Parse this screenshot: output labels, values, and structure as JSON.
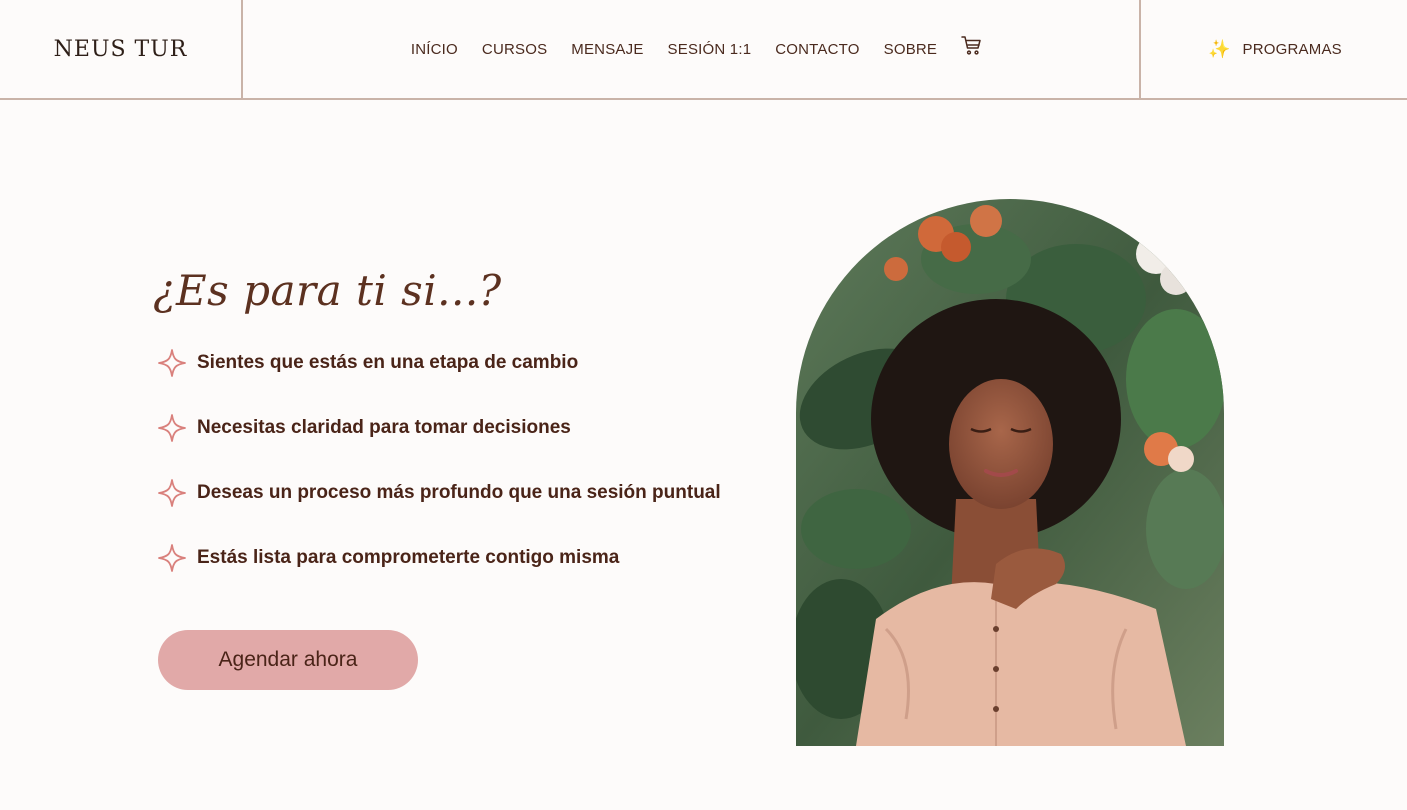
{
  "header": {
    "logo": "NEUS TUR",
    "nav": [
      "INÍCIO",
      "CURSOS",
      "MENSAJE",
      "SESIÓN 1:1",
      "CONTACTO",
      "SOBRE"
    ],
    "cart_icon": "cart-icon",
    "programs_icon": "sparkles-icon",
    "programs_label": "PROGRAMAS"
  },
  "main": {
    "heading": "¿Es para ti si...?",
    "items": [
      "Sientes que estás en una etapa de cambio",
      "Necesitas claridad para tomar decisiones",
      "Deseas un proceso más profundo que una sesión puntual",
      "Estás lista para comprometerte contigo misma"
    ],
    "cta_label": "Agendar ahora"
  },
  "colors": {
    "background": "#fdfbfa",
    "accent": "#e1a9a8",
    "text_dark": "#4a2418",
    "divider": "#c9b3a8"
  }
}
